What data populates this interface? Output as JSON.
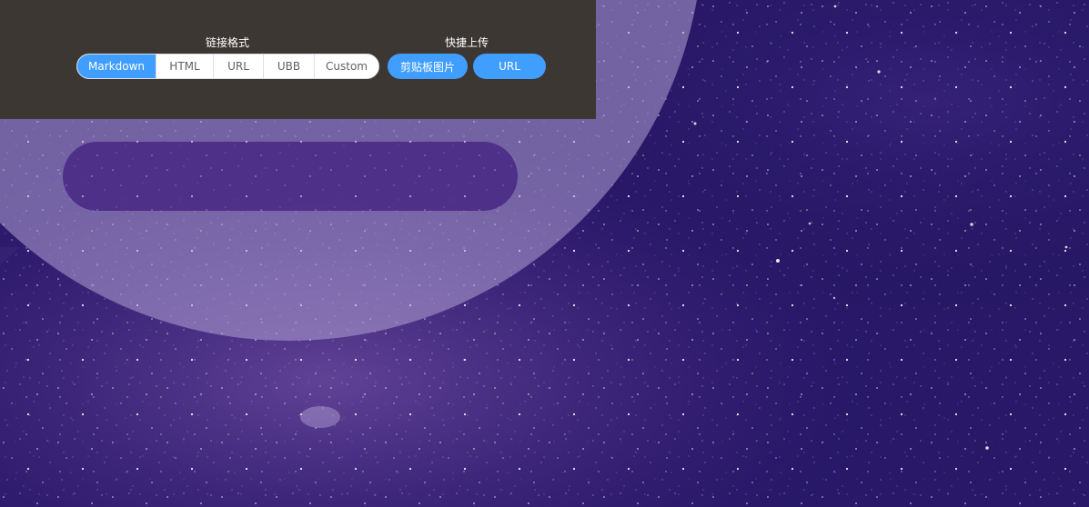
{
  "link_format": {
    "title": "链接格式",
    "options": [
      "Markdown",
      "HTML",
      "URL",
      "UBB",
      "Custom"
    ],
    "selected": "Markdown"
  },
  "quick_upload": {
    "title": "快捷上传",
    "clipboard_label": "剪贴板图片",
    "url_label": "URL"
  },
  "colors": {
    "panel": "#3c3733",
    "accent": "#409eff",
    "background": "#2a1a66"
  }
}
